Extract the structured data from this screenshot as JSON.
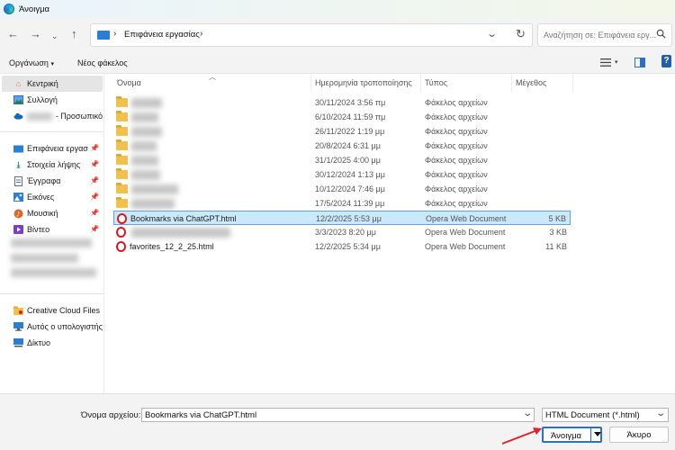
{
  "window": {
    "title": "Άνοιγμα"
  },
  "address_bar": {
    "location": "Επιφάνεια εργασίας"
  },
  "search": {
    "placeholder": "Αναζήτηση σε: Επιφάνεια εργ..."
  },
  "toolbar": {
    "organize": "Οργάνωση",
    "new_folder": "Νέος φάκελος"
  },
  "sidebar": {
    "home": "Κεντρική",
    "gallery": "Συλλογή",
    "onedrive": "- Προσωπικό",
    "quick_access": [
      {
        "label": "Επιφάνεια εργασ"
      },
      {
        "label": "Στοιχεία λήψης"
      },
      {
        "label": "Έγγραφα"
      },
      {
        "label": "Εικόνες"
      },
      {
        "label": "Μουσική"
      },
      {
        "label": "Βίντεο"
      }
    ],
    "bottom": [
      {
        "label": "Creative Cloud Files P"
      },
      {
        "label": "Αυτός ο υπολογιστής"
      },
      {
        "label": "Δίκτυο"
      }
    ]
  },
  "columns": {
    "name": "Όνομα",
    "date": "Ημερομηνία τροποποίησης",
    "type": "Τύπος",
    "size": "Μέγεθος"
  },
  "rows": [
    {
      "name": "",
      "date": "30/11/2024 3:56 πμ",
      "type": "Φάκελος αρχείων",
      "size": ""
    },
    {
      "name": "",
      "date": "6/10/2024 11:59 πμ",
      "type": "Φάκελος αρχείων",
      "size": ""
    },
    {
      "name": "",
      "date": "26/11/2022 1:19 μμ",
      "type": "Φάκελος αρχείων",
      "size": ""
    },
    {
      "name": "",
      "date": "20/8/2024 6:31 μμ",
      "type": "Φάκελος αρχείων",
      "size": ""
    },
    {
      "name": "",
      "date": "31/1/2025 4:00 μμ",
      "type": "Φάκελος αρχείων",
      "size": ""
    },
    {
      "name": "",
      "date": "30/12/2024 1:13 μμ",
      "type": "Φάκελος αρχείων",
      "size": ""
    },
    {
      "name": "",
      "date": "10/12/2024 7:46 μμ",
      "type": "Φάκελος αρχείων",
      "size": ""
    },
    {
      "name": "",
      "date": "17/5/2024 11:39 μμ",
      "type": "Φάκελος αρχείων",
      "size": ""
    },
    {
      "name": "Bookmarks via ChatGPT.html",
      "date": "12/2/2025 5:53 μμ",
      "type": "Opera Web Document",
      "size": "5 KB"
    },
    {
      "name": "",
      "date": "3/3/2023 8:20 μμ",
      "type": "Opera Web Document",
      "size": "3 KB"
    },
    {
      "name": "favorites_12_2_25.html",
      "date": "12/2/2025 5:34 μμ",
      "type": "Opera Web Document",
      "size": "11 KB"
    }
  ],
  "footer": {
    "filename_label": "Όνομα αρχείου:",
    "filename_value": "Bookmarks via ChatGPT.html",
    "filetype": "HTML Document (*.html)",
    "open": "Άνοιγμα",
    "cancel": "Άκυρο"
  },
  "colors": {
    "accent": "#2b6fc9",
    "selection": "#cce8ff",
    "folder": "#f2c14a",
    "opera": "#e0161f",
    "annotation": "#e0202a"
  }
}
